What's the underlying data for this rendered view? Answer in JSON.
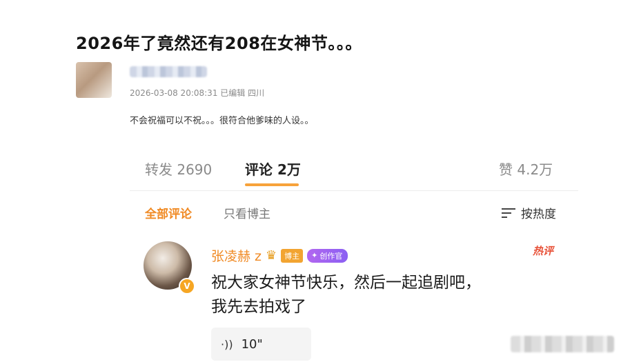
{
  "post": {
    "title": "2026年了竟然还有208在女神节。。。",
    "meta": "2026-03-08 20:08:31 已编辑 四川",
    "text": "不会祝福可以不祝。。。很符合他爹味的人设。。"
  },
  "tabs": {
    "repost": "转发 2690",
    "comments": "评论 2万",
    "likes": "赞 4.2万"
  },
  "filters": {
    "all_comments": "全部评论",
    "author_only": "只看博主",
    "sort_label": "按热度"
  },
  "comment": {
    "author": "张凌赫 z",
    "badge_blogger": "博主",
    "badge_creator": "创作官",
    "hot_label": "热评",
    "text_line1": "祝大家女神节快乐，然后一起追剧吧，",
    "text_line2": "我先去拍戏了",
    "voice_length": "10\""
  },
  "colors": {
    "accent_orange": "#f08a24",
    "underline": "#f7a23a",
    "hot_red": "#e8533a",
    "creator_purple": "#a264f1"
  },
  "icons": {
    "sort": "sort-lines-icon",
    "voice": "voice-wave-icon",
    "crown": "crown-icon",
    "verified": "verified-v-icon"
  }
}
